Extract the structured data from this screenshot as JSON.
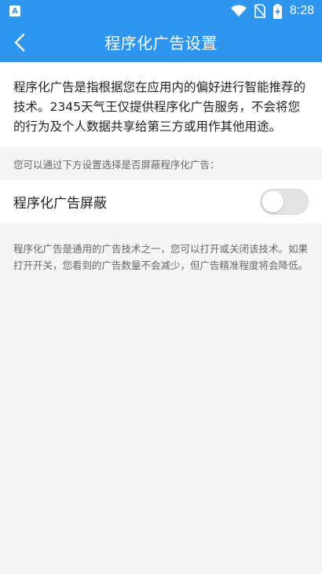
{
  "status_bar": {
    "app_badge": "A",
    "time": "8:28",
    "icons": [
      "wifi-icon",
      "no-sim-icon",
      "battery-charging-icon"
    ]
  },
  "app_bar": {
    "back_icon": "chevron-left-icon",
    "title": "程序化广告设置"
  },
  "intro": {
    "text": "程序化广告是指根据您在应用内的偏好进行智能推荐的技术。2345天气王仅提供程序化广告服务，不会将您的行为及个人数据共享给第三方或用作其他用途。"
  },
  "section_hint": "您可以通过下方设置选择是否屏蔽程序化广告：",
  "setting": {
    "label": "程序化广告屏蔽",
    "enabled": false
  },
  "footnote": "程序化广告是通用的广告技术之一，您可以打开或关闭该技术。如果打开开关，您看到的广告数量不会减少，但广告精准程度将会降低。",
  "colors": {
    "primary": "#2f96f0",
    "background": "#f5f5f5",
    "toggle_off": "#e4e4e4"
  }
}
